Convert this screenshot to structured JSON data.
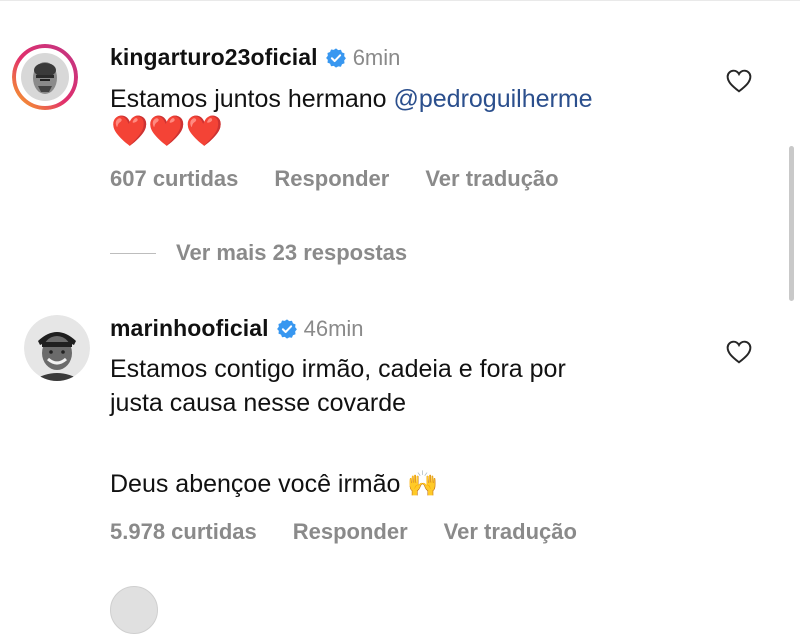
{
  "comments": [
    {
      "username": "kingarturo23oficial",
      "time": "6min",
      "text": "Estamos juntos hermano ",
      "mention": "@pedroguilherme",
      "emoji_line": "❤️❤️❤️",
      "likes": "607 curtidas",
      "reply_label": "Responder",
      "translate_label": "Ver tradução"
    },
    {
      "username": "marinhooficial",
      "time": "46min",
      "text_line1": "Estamos contigo irmão, cadeia e fora por",
      "text_line2": "justa causa nesse covarde",
      "text_line3": "Deus abençoe você irmão 🙌",
      "likes": "5.978 curtidas",
      "reply_label": "Responder",
      "translate_label": "Ver tradução"
    }
  ],
  "more_replies": "Ver mais 23 respostas",
  "colors": {
    "verified": "#3897f0",
    "mention": "#2b4f8d",
    "heart": "#e0245e",
    "secondary_text": "#8a8a8a"
  },
  "icons": [
    "verified-badge-icon",
    "like-heart-icon",
    "red-heart-emoji-icon",
    "raising-hands-emoji"
  ]
}
